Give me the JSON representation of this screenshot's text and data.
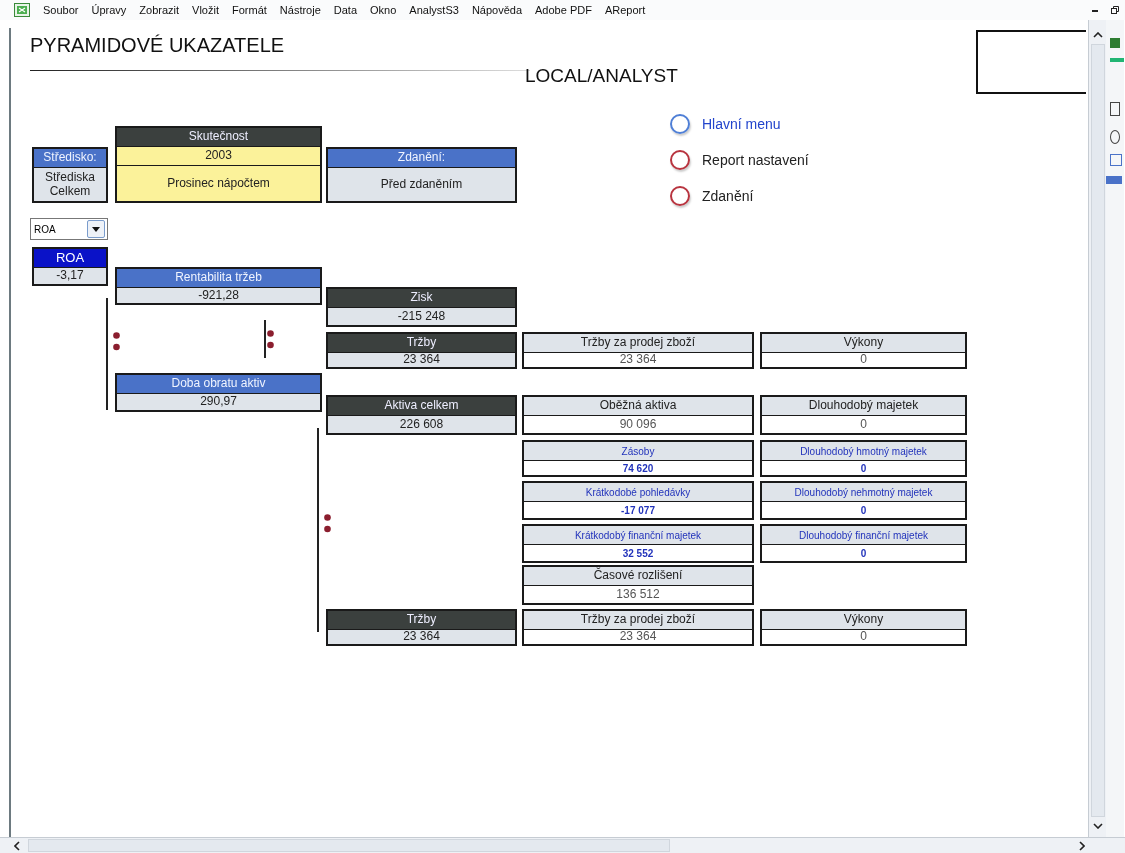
{
  "menu_bar": [
    "Soubor",
    "Úpravy",
    "Zobrazit",
    "Vložit",
    "Formát",
    "Nástroje",
    "Data",
    "Okno",
    "AnalystS3",
    "Nápověda",
    "Adobe PDF",
    "AReport"
  ],
  "sheet": {
    "title": "PYRAMIDOVÉ UKAZATELE",
    "subtitle": "LOCAL/ANALYST",
    "links": [
      {
        "label": "Hlavní menu",
        "selected": true
      },
      {
        "label": "Report nastavení",
        "selected": false
      },
      {
        "label": "Zdanění",
        "selected": false
      }
    ],
    "dropdown": {
      "value": "ROA"
    },
    "tiles": [
      {
        "rows": [
          {
            "text": "Středisko:",
            "kind": "blue"
          },
          {
            "text": "Střediska Celkem",
            "kind": "light"
          }
        ]
      },
      {
        "rows": [
          {
            "text": "Skutečnost",
            "kind": "dark"
          },
          {
            "text": "2003",
            "kind": "yellow"
          },
          {
            "text": "Prosinec nápočtem",
            "kind": "yellow"
          }
        ]
      },
      {
        "rows": [
          {
            "text": "Zdanění:",
            "kind": "blue"
          },
          {
            "text": "Před zdaněním",
            "kind": "light"
          }
        ]
      },
      {
        "rows": [
          {
            "text": "ROA",
            "kind": "navy"
          },
          {
            "text": "-3,17",
            "kind": "light"
          }
        ]
      },
      {
        "rows": [
          {
            "text": "Rentabilita tržeb",
            "kind": "blue"
          },
          {
            "text": "-921,28",
            "kind": "light"
          }
        ]
      },
      {
        "rows": [
          {
            "text": "Zisk",
            "kind": "dark"
          },
          {
            "text": "-215 248",
            "kind": "light"
          }
        ]
      },
      {
        "rows": [
          {
            "text": "Tržby",
            "kind": "dark"
          },
          {
            "text": "23 364",
            "kind": "light"
          }
        ]
      },
      {
        "rows": [
          {
            "text": "Tržby za prodej zboží",
            "kind": "light"
          },
          {
            "text": "23 364",
            "kind": "white"
          }
        ]
      },
      {
        "rows": [
          {
            "text": "Výkony",
            "kind": "light"
          },
          {
            "text": "0",
            "kind": "white"
          }
        ]
      },
      {
        "rows": [
          {
            "text": "Doba obratu aktiv",
            "kind": "blue"
          },
          {
            "text": "290,97",
            "kind": "light"
          }
        ]
      },
      {
        "rows": [
          {
            "text": "Aktiva celkem",
            "kind": "dark"
          },
          {
            "text": "226 608",
            "kind": "light"
          }
        ]
      },
      {
        "rows": [
          {
            "text": "Oběžná aktiva",
            "kind": "light"
          },
          {
            "text": "90 096",
            "kind": "white"
          }
        ]
      },
      {
        "rows": [
          {
            "text": "Dlouhodobý majetek",
            "kind": "light"
          },
          {
            "text": "0",
            "kind": "white"
          }
        ]
      },
      {
        "rows": [
          {
            "text": "Zásoby",
            "kind": "sublabel"
          },
          {
            "text": "74 620",
            "kind": "subvalue"
          }
        ]
      },
      {
        "rows": [
          {
            "text": "Dlouhodobý hmotný majetek",
            "kind": "sublabel"
          },
          {
            "text": "0",
            "kind": "subvalue"
          }
        ]
      },
      {
        "rows": [
          {
            "text": "Krátkodobé pohledávky",
            "kind": "sublabel"
          },
          {
            "text": "-17 077",
            "kind": "subvalue"
          }
        ]
      },
      {
        "rows": [
          {
            "text": "Dlouhodobý nehmotný majetek",
            "kind": "sublabel"
          },
          {
            "text": "0",
            "kind": "subvalue"
          }
        ]
      },
      {
        "rows": [
          {
            "text": "Krátkodobý finanční majetek",
            "kind": "sublabel"
          },
          {
            "text": "32 552",
            "kind": "subvalue"
          }
        ]
      },
      {
        "rows": [
          {
            "text": "Dlouhodobý finanční majetek",
            "kind": "sublabel"
          },
          {
            "text": "0",
            "kind": "subvalue"
          }
        ]
      },
      {
        "rows": [
          {
            "text": "Časové rozlišení",
            "kind": "light"
          },
          {
            "text": "136 512",
            "kind": "white"
          }
        ]
      },
      {
        "rows": [
          {
            "text": "Tržby",
            "kind": "dark"
          },
          {
            "text": "23 364",
            "kind": "light"
          }
        ]
      },
      {
        "rows": [
          {
            "text": "Tržby za prodej zboží",
            "kind": "light"
          },
          {
            "text": "23 364",
            "kind": "white"
          }
        ]
      },
      {
        "rows": [
          {
            "text": "Výkony",
            "kind": "light"
          },
          {
            "text": "0",
            "kind": "white"
          }
        ]
      }
    ]
  }
}
